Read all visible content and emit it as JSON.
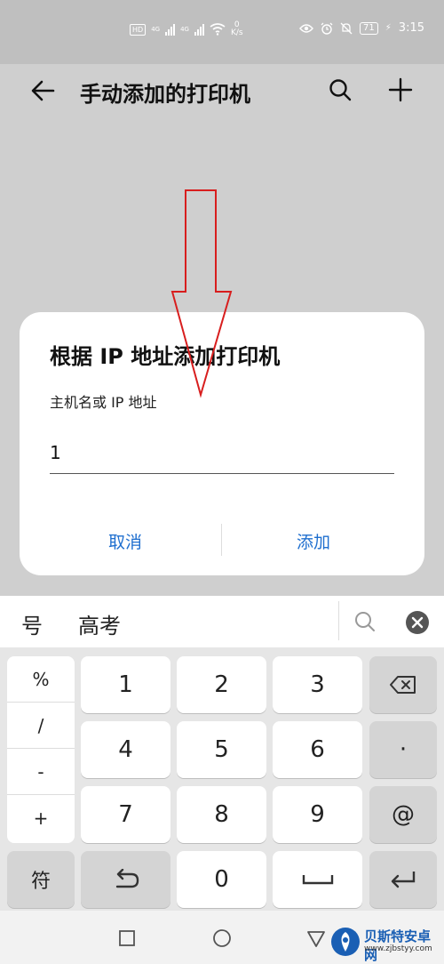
{
  "status_bar": {
    "hd_label": "HD",
    "net_label_1": "4G",
    "net_label_2": "4G",
    "net_speed_value": "0",
    "net_speed_unit": "K/s",
    "battery": "71",
    "time": "3:15"
  },
  "app_bar": {
    "title": "手动添加的打印机"
  },
  "dialog": {
    "title": "根据 IP 地址添加打印机",
    "field_label": "主机名或 IP 地址",
    "field_value": "1",
    "cancel_label": "取消",
    "add_label": "添加"
  },
  "keyboard": {
    "suggestions": [
      "号",
      "高考"
    ],
    "symbols": [
      "%",
      "/",
      "-",
      "+"
    ],
    "rows": [
      [
        "1",
        "2",
        "3"
      ],
      [
        "4",
        "5",
        "6"
      ],
      [
        "7",
        "8",
        "9"
      ]
    ],
    "dot_key": "·",
    "at_key": "@",
    "symbol_switch": "符",
    "zero_key": "0"
  },
  "watermark": {
    "title": "贝斯特安卓网",
    "url": "www.zjbstyy.com"
  },
  "colors": {
    "accent": "#1f6fcf",
    "annotation": "#d81e1e",
    "overlay": "#cfcfcf"
  }
}
